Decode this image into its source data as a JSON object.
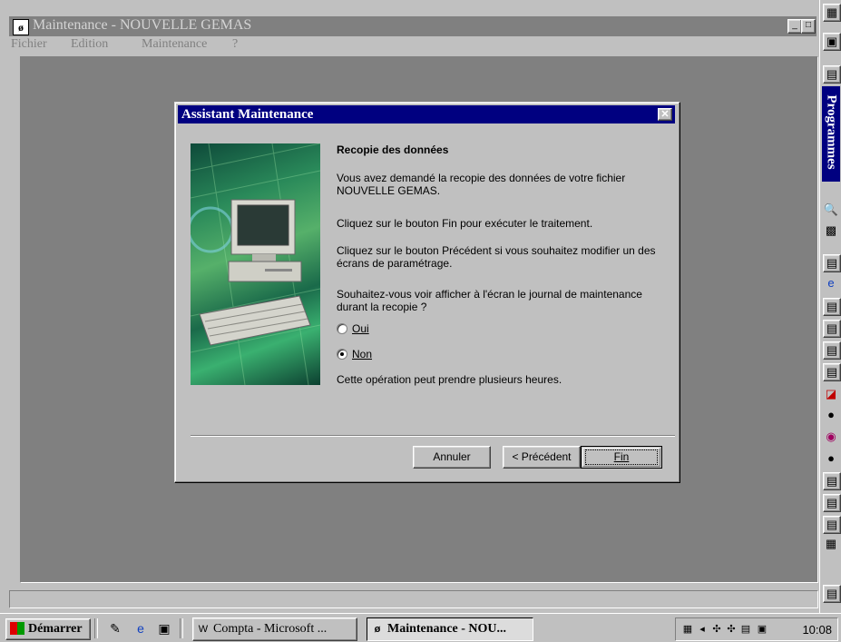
{
  "app": {
    "title": "Maintenance - NOUVELLE GEMAS",
    "menu": [
      "Fichier",
      "Edition",
      "Maintenance",
      "?"
    ]
  },
  "dialog": {
    "title": "Assistant Maintenance",
    "heading": "Recopie des données",
    "paragraphs": [
      "Vous avez demandé la recopie des données de votre fichier NOUVELLE GEMAS.",
      "Cliquez sur le bouton Fin pour exécuter le traitement.",
      "Cliquez sur le bouton Précédent si vous souhaitez modifier un des écrans de paramétrage.",
      "Souhaitez-vous voir afficher à l'écran le journal de maintenance durant la recopie ?"
    ],
    "options": [
      {
        "label": "Oui",
        "selected": false
      },
      {
        "label": "Non",
        "selected": true
      }
    ],
    "warning": "Cette opération peut prendre plusieurs heures.",
    "buttons": {
      "cancel": "Annuler",
      "back": "< Précédent",
      "finish": "Fin"
    }
  },
  "sidebar": {
    "label": "Programmes"
  },
  "taskbar": {
    "start": "Démarrer",
    "tasks": [
      "Compta - Microsoft ...",
      "Maintenance - NOU..."
    ],
    "clock": "10:08"
  }
}
